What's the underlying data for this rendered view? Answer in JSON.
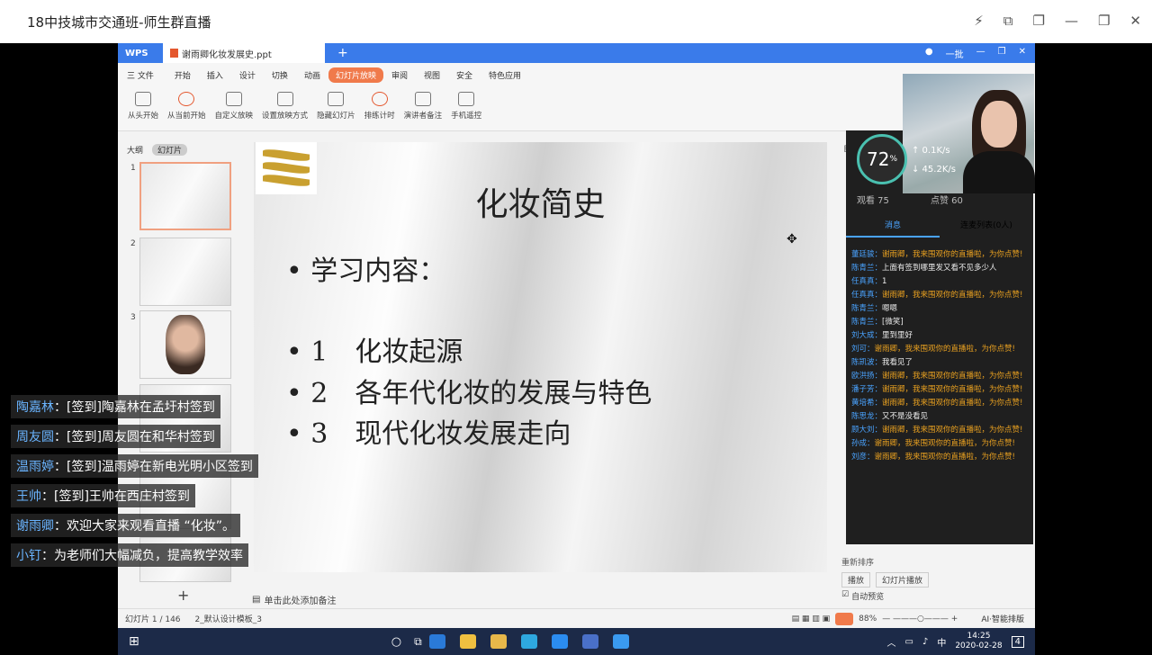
{
  "window": {
    "title": "18中技城市交通班-师生群直播"
  },
  "wps": {
    "app_tab": "WPS",
    "doc_tab": "谢雨卿化妆发展史.ppt",
    "user_label": "一批",
    "menu": [
      "开始",
      "插入",
      "设计",
      "切换",
      "动画",
      "幻灯片放映",
      "审阅",
      "视图",
      "安全",
      "特色应用"
    ],
    "file_menu": "三 文件",
    "toolbar": [
      "从头开始",
      "从当前开始",
      "自定义放映",
      "设置放映方式",
      "隐藏幻灯片",
      "排练计时",
      "演讲者备注",
      "手机遥控"
    ],
    "thumb_tabs": [
      "大纲",
      "幻灯片"
    ],
    "notes_placeholder": "单击此处添加备注",
    "status": {
      "slide": "幻灯片 1 / 146",
      "template": "2_默认设计模板_3",
      "zoom": "88%",
      "ai": "AI·智能排版"
    },
    "right_pane": {
      "label": "自定",
      "sort": "重新排序",
      "play": "播放",
      "slideshow": "幻灯片播放",
      "autopreview": "自动预览"
    }
  },
  "slide": {
    "title": "化妆简史",
    "subtitle": "• 学习内容：",
    "bullets": [
      "• 1　化妆起源",
      "• 2　各年代化妆的发展与特色",
      "• 3　现代化妆发展走向"
    ]
  },
  "live": {
    "meter_value": "72",
    "meter_unit": "%",
    "speed_up": "↑ 0.1K/s",
    "speed_down": "↓ 45.2K/s",
    "viewers": "观看 75",
    "likes": "点赞 60",
    "tabs": [
      "消息",
      "连麦列表(0人)"
    ],
    "chat": [
      {
        "name": "董廷骏",
        "text": "谢雨卿，我来围观你的直播啦，为你点赞!",
        "style": "o"
      },
      {
        "name": "陈青兰",
        "text": "上面有签到哪里发又看不见多少人",
        "style": "w"
      },
      {
        "name": "任真真",
        "text": "1",
        "style": "w"
      },
      {
        "name": "任真真",
        "text": "谢雨卿，我来围观你的直播啦，为你点赞!",
        "style": "o"
      },
      {
        "name": "陈青兰",
        "text": "嗯嗯",
        "style": "w"
      },
      {
        "name": "陈青兰",
        "text": "[微笑]",
        "style": "w"
      },
      {
        "name": "刘大成",
        "text": "里到里好",
        "style": "w"
      },
      {
        "name": "刘可",
        "text": "谢雨卿，我来围观你的直播啦，为你点赞!",
        "style": "o"
      },
      {
        "name": "陈凯波",
        "text": "我看见了",
        "style": "w"
      },
      {
        "name": "欧洪扬",
        "text": "谢雨卿，我来围观你的直播啦，为你点赞!",
        "style": "o"
      },
      {
        "name": "潘子芳",
        "text": "谢雨卿，我来围观你的直播啦，为你点赞!",
        "style": "o"
      },
      {
        "name": "黄培希",
        "text": "谢雨卿，我来围观你的直播啦，为你点赞!",
        "style": "o"
      },
      {
        "name": "陈思龙",
        "text": "又不是没看见",
        "style": "w"
      },
      {
        "name": "顾大刘",
        "text": "谢雨卿，我来围观你的直播啦，为你点赞!",
        "style": "o"
      },
      {
        "name": "孙成",
        "text": "谢雨卿，我来围观你的直播啦，为你点赞!",
        "style": "o"
      },
      {
        "name": "刘彦",
        "text": "谢雨卿，我来围观你的直播啦，为你点赞!",
        "style": "o"
      }
    ]
  },
  "danmaku": [
    {
      "name": "陶嘉林",
      "text": "：[签到]陶嘉林在孟圩村签到"
    },
    {
      "name": "周友圆",
      "text": "：[签到]周友圆在和华村签到"
    },
    {
      "name": "温雨婷",
      "text": "：[签到]温雨婷在新电光明小区签到"
    },
    {
      "name": "王帅",
      "text": "：[签到]王帅在西庄村签到"
    },
    {
      "name": "谢雨卿",
      "text": "：欢迎大家来观看直播 “化妆”。"
    },
    {
      "name": "小钉",
      "text": "：为老师们大幅减负，提高教学效率"
    }
  ],
  "taskbar": {
    "ime": "中",
    "time": "14:25",
    "date": "2020-02-28",
    "notify": "4"
  }
}
